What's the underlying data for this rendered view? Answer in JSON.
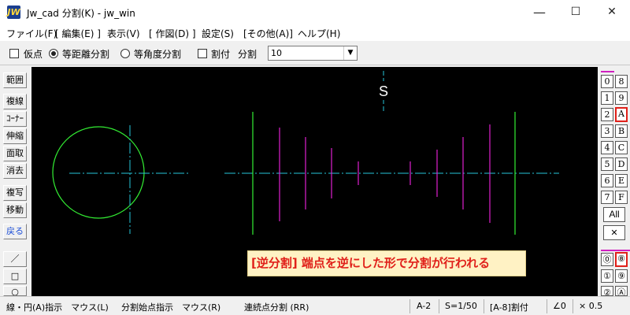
{
  "window": {
    "icon_text": "JW",
    "title": "Jw_cad 分割(K) - jw_win",
    "minimize": "—",
    "maximize": "☐",
    "close": "✕"
  },
  "menu": [
    "ファイル(F)",
    "[ 編集(E) ]",
    "表示(V)",
    "[ 作図(D) ]",
    "設定(S)",
    "[その他(A)]",
    "ヘルプ(H)"
  ],
  "toolbar": {
    "kari_ten": "仮点",
    "tou_kyori": "等距離分割",
    "tou_kakudo": "等角度分割",
    "waritsuke": "割付",
    "bunkatsu_label": "分割",
    "bunkatsu_value": "10",
    "dropdown_arrow": "▼"
  },
  "left_tools": [
    "範囲",
    "複線",
    "ｺｰﾅｰ",
    "伸縮",
    "面取",
    "消去",
    "複写",
    "移動",
    "戻る"
  ],
  "left_shapes": [
    "／",
    "□",
    "○"
  ],
  "right_panel": {
    "layer_left": [
      "0",
      "1",
      "2",
      "3",
      "4",
      "5",
      "6",
      "7"
    ],
    "layer_right": [
      "8",
      "9",
      "A",
      "B",
      "C",
      "D",
      "E",
      "F"
    ],
    "all": "All",
    "cross": "✕",
    "group_left": [
      "⓪",
      "①",
      "②"
    ],
    "group_right": [
      "⑧",
      "⑨",
      "Ⓐ"
    ]
  },
  "canvas": {
    "marker": "S",
    "colors": {
      "background": "#000000",
      "circle": "#33ee33",
      "centerline": "#26c6da",
      "outer_lines": "#33ee33",
      "division_lines": "#e020d0"
    }
  },
  "caption": "[逆分割] 端点を逆にした形で分割が行われる",
  "status": {
    "left": "線・円(A)指示　マウス(L)",
    "mid": "分割始点指示　マウス(R)",
    "right": "連続点分割 (RR)",
    "layer": "A-2",
    "scale": "S=1/50",
    "mode": "[A-8]割付",
    "angle": "∠0",
    "zoom": "× 0.5"
  },
  "colors": {
    "accent_red": "#e0201a",
    "caption_bg": "#fff2c4",
    "blue_text": "#1e50d8"
  }
}
